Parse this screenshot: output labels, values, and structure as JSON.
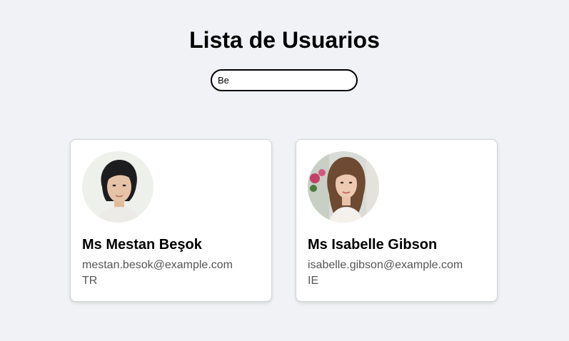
{
  "header": {
    "title": "Lista de Usuarios"
  },
  "search": {
    "value": "Be",
    "placeholder": ""
  },
  "users": [
    {
      "name": "Ms Mestan Beşok",
      "email": "mestan.besok@example.com",
      "country": "TR",
      "avatar_icon": "user-photo-icon"
    },
    {
      "name": "Ms Isabelle Gibson",
      "email": "isabelle.gibson@example.com",
      "country": "IE",
      "avatar_icon": "user-photo-icon"
    }
  ],
  "colors": {
    "background": "#f0f2f5",
    "card": "#ffffff",
    "text_secondary": "#555555"
  }
}
